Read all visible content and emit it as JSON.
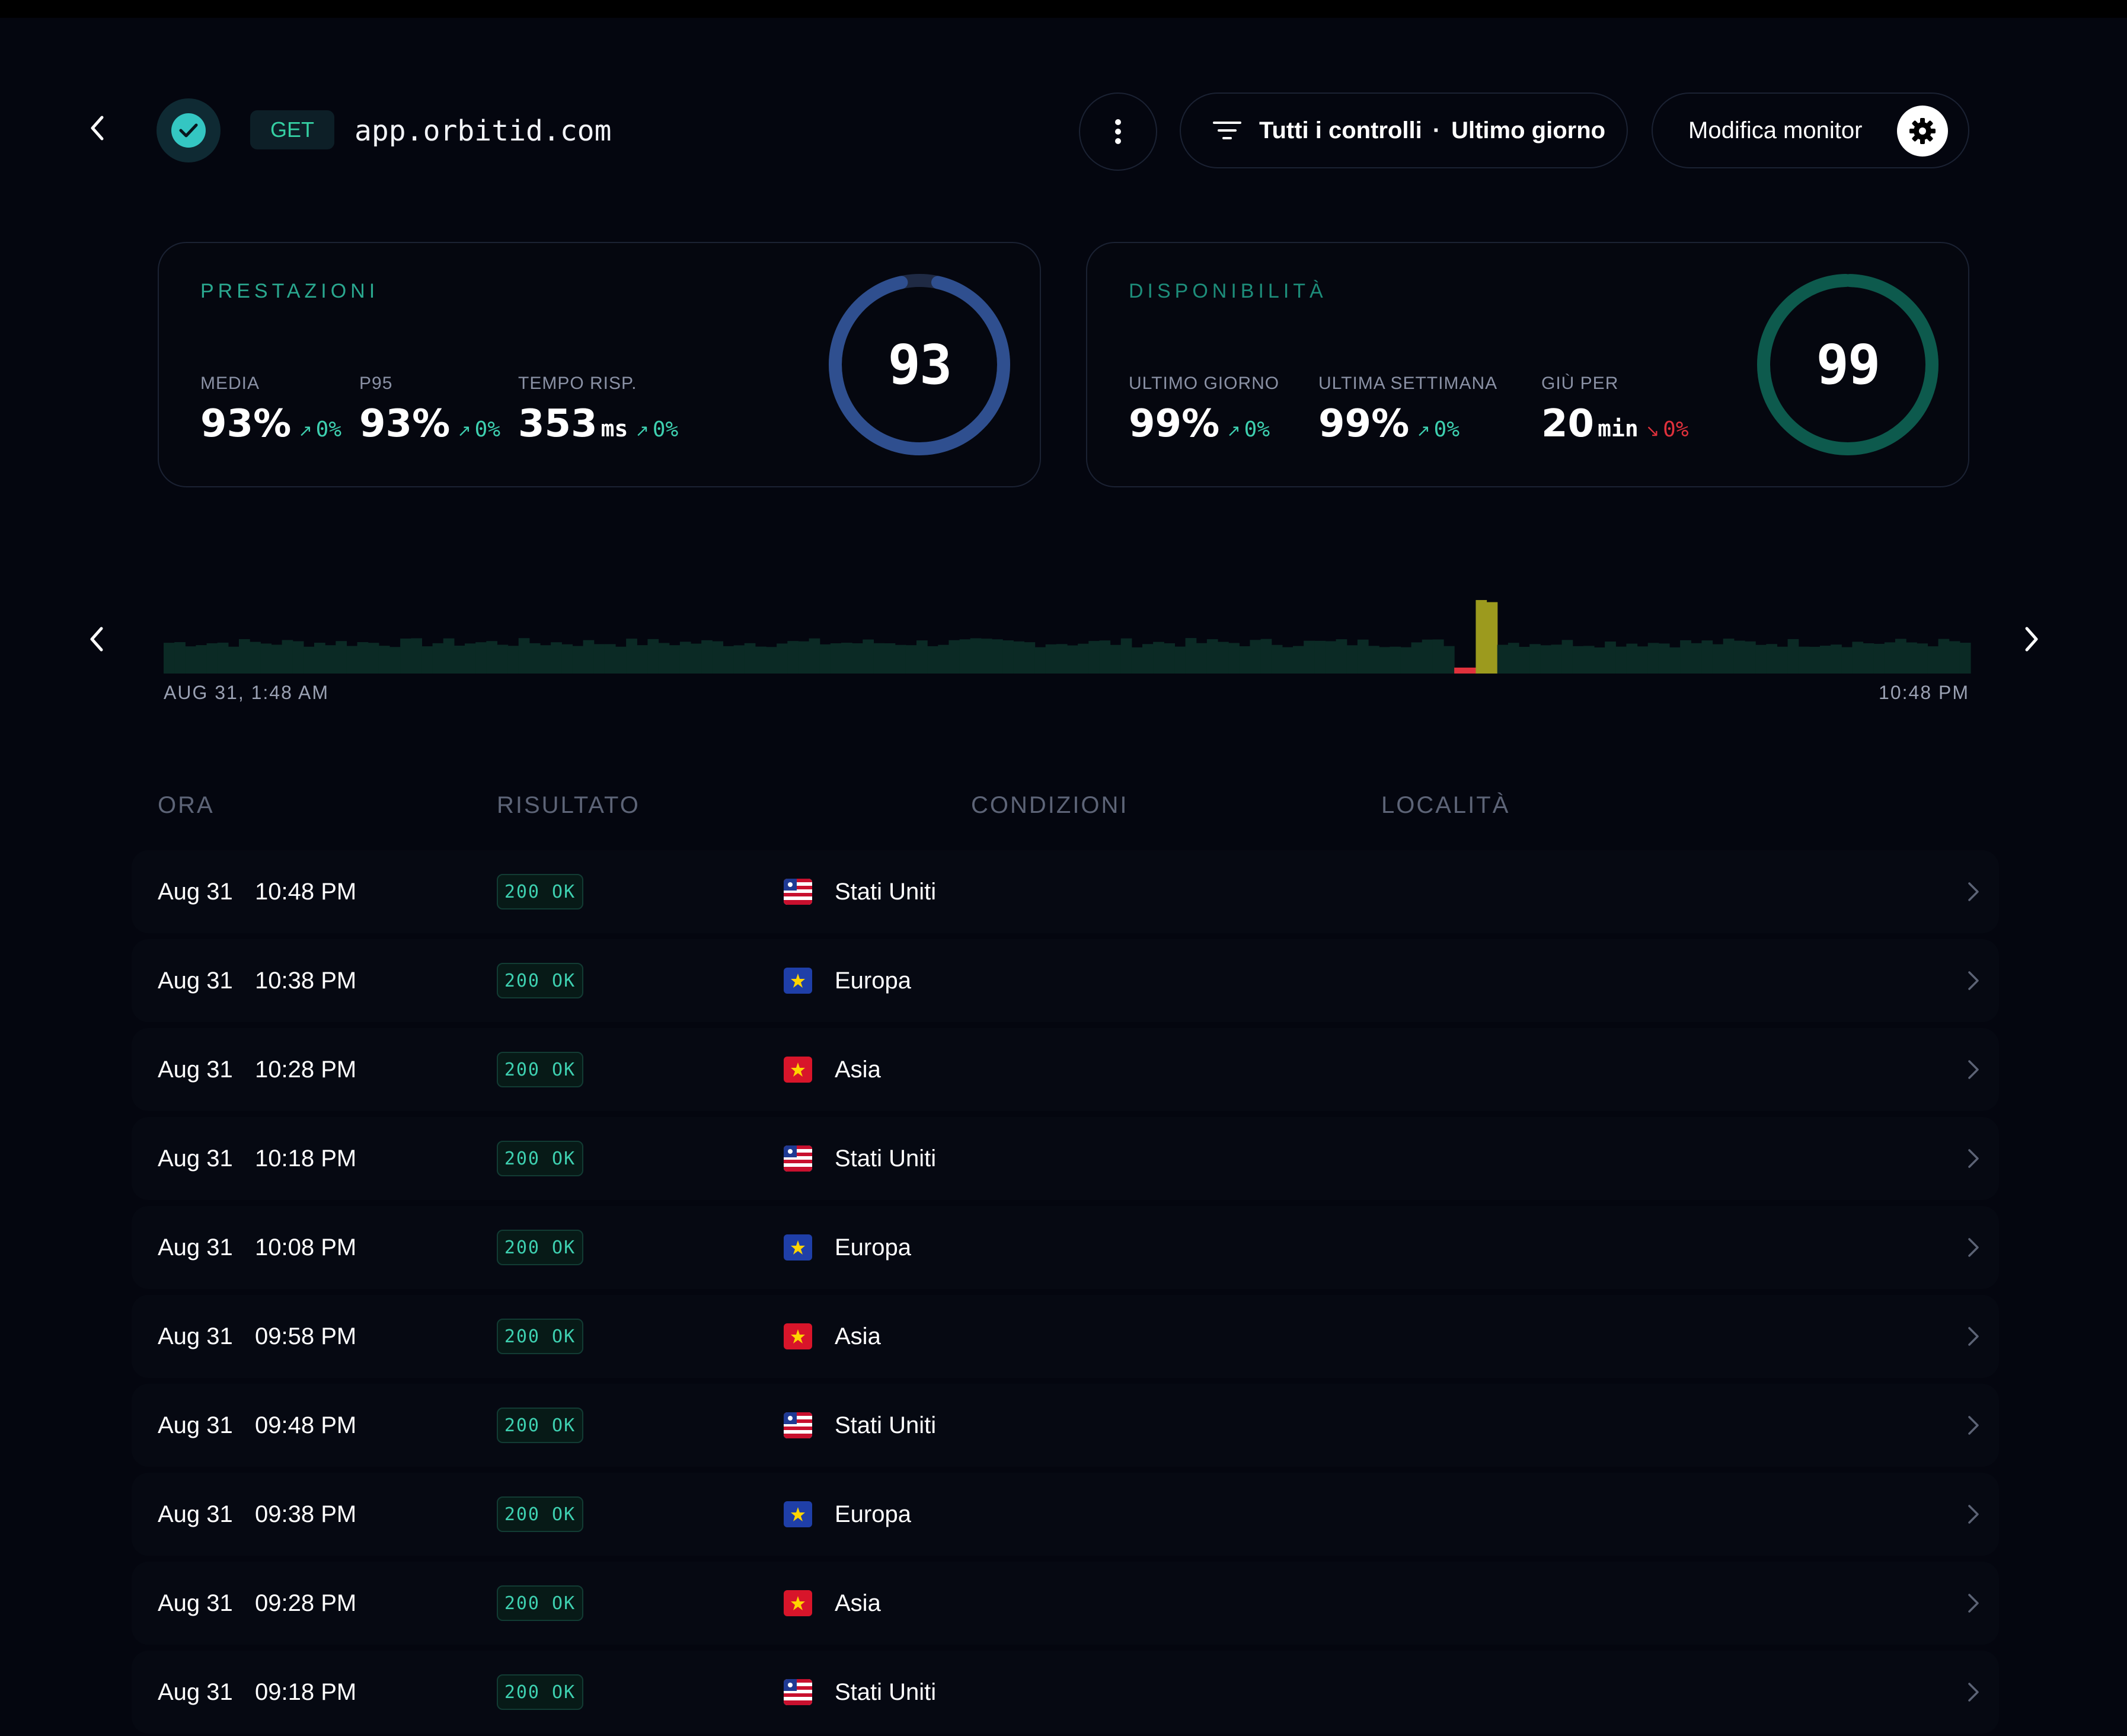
{
  "header": {
    "method": "GET",
    "url": "app.orbitid.com",
    "filter_checks": "Tutti i controlli",
    "filter_separator": "·",
    "filter_range": "Ultimo giorno",
    "edit_label": "Modifica monitor"
  },
  "performance": {
    "title": "PRESTAZIONI",
    "score": "93",
    "score_fraction": 0.93,
    "metrics": [
      {
        "label": "MEDIA",
        "value": "93%",
        "unit": "",
        "arrow": "↗",
        "change": "0%",
        "trend": "up"
      },
      {
        "label": "P95",
        "value": "93%",
        "unit": "",
        "arrow": "↗",
        "change": "0%",
        "trend": "up"
      },
      {
        "label": "TEMPO RISP.",
        "value": "353",
        "unit": "ms",
        "arrow": "↗",
        "change": "0%",
        "trend": "up"
      }
    ]
  },
  "availability": {
    "title": "DISPONIBILITÀ",
    "score": "99",
    "score_fraction": 0.99,
    "metrics": [
      {
        "label": "ULTIMO GIORNO",
        "value": "99%",
        "unit": "",
        "arrow": "↗",
        "change": "0%",
        "trend": "up"
      },
      {
        "label": "ULTIMA SETTIMANA",
        "value": "99%",
        "unit": "",
        "arrow": "↗",
        "change": "0%",
        "trend": "up"
      },
      {
        "label": "GIÙ PER",
        "value": "20",
        "unit": "min",
        "arrow": "↘",
        "change": "0%",
        "trend": "down"
      }
    ]
  },
  "timeline": {
    "start_label": "AUG 31, 1:48 AM",
    "end_label": "10:48 PM",
    "highlight": [
      {
        "index": 120,
        "status": "down"
      },
      {
        "index": 121,
        "status": "down"
      },
      {
        "index": 122,
        "status": "degraded"
      },
      {
        "index": 123,
        "status": "degraded"
      }
    ]
  },
  "table": {
    "columns": [
      "ORA",
      "RISULTATO",
      "CONDIZIONI",
      "LOCALITÀ"
    ],
    "rows": [
      {
        "date": "Aug 31",
        "time": "10:48 PM",
        "result": "200 OK",
        "region": "us",
        "location": "Stati Uniti"
      },
      {
        "date": "Aug 31",
        "time": "10:38 PM",
        "result": "200 OK",
        "region": "eu",
        "location": "Europa"
      },
      {
        "date": "Aug 31",
        "time": "10:28 PM",
        "result": "200 OK",
        "region": "asia",
        "location": "Asia"
      },
      {
        "date": "Aug 31",
        "time": "10:18 PM",
        "result": "200 OK",
        "region": "us",
        "location": "Stati Uniti"
      },
      {
        "date": "Aug 31",
        "time": "10:08 PM",
        "result": "200 OK",
        "region": "eu",
        "location": "Europa"
      },
      {
        "date": "Aug 31",
        "time": "09:58 PM",
        "result": "200 OK",
        "region": "asia",
        "location": "Asia"
      },
      {
        "date": "Aug 31",
        "time": "09:48 PM",
        "result": "200 OK",
        "region": "us",
        "location": "Stati Uniti"
      },
      {
        "date": "Aug 31",
        "time": "09:38 PM",
        "result": "200 OK",
        "region": "eu",
        "location": "Europa"
      },
      {
        "date": "Aug 31",
        "time": "09:28 PM",
        "result": "200 OK",
        "region": "asia",
        "location": "Asia"
      },
      {
        "date": "Aug 31",
        "time": "09:18 PM",
        "result": "200 OK",
        "region": "us",
        "location": "Stati Uniti"
      }
    ]
  },
  "colors": {
    "accent_green": "#3ed0b0",
    "down_red": "#e0313c",
    "perf_ring": "#2f4f8f",
    "avail_ring": "#0d5a4d",
    "degraded": "#9c9a1e",
    "timeline_bar": "#0b2a25"
  },
  "icons": {
    "back": "chevron-left-icon",
    "status": "check-circle-icon",
    "more": "kebab-menu-icon",
    "filter": "filter-lines-icon",
    "settings": "gear-icon",
    "row_open": "chevron-right-icon"
  }
}
